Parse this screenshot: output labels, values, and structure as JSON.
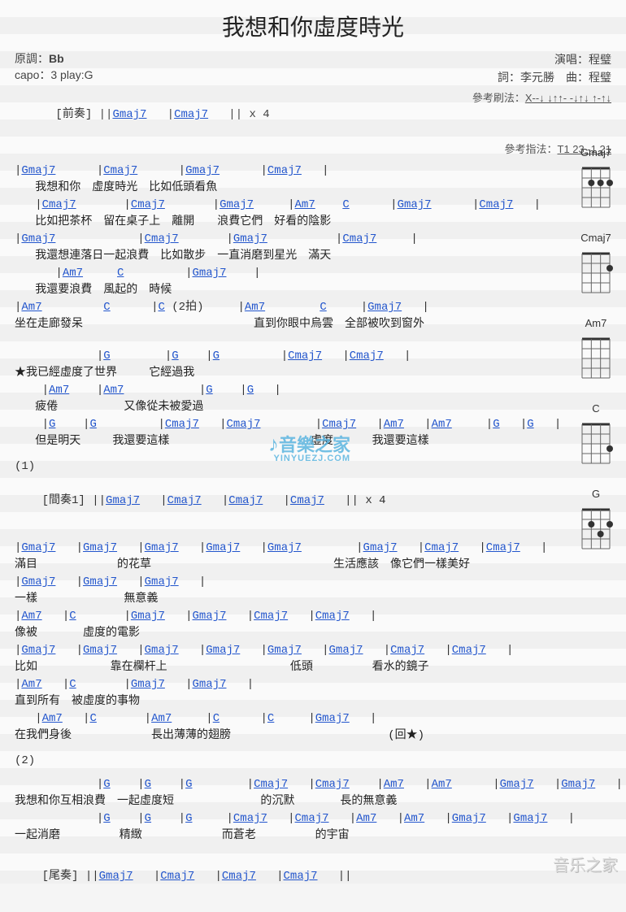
{
  "title": "我想和你虛度時光",
  "meta": {
    "key_label": "原調：",
    "key": "Bb",
    "capo": "capo：3 play:G",
    "singer_label": "演唱：",
    "singer": "程璧",
    "lyricist_label": "詞：",
    "lyricist": "李元勝",
    "composer_label": "曲：",
    "composer": "程璧"
  },
  "ref": {
    "strum_label": "參考刷法：",
    "strum": "X--↓ ↓↑↑- -↓↑↓ ↑-↑↓",
    "finger_label": "參考指法：",
    "finger": "T1 23 -1 21"
  },
  "intro": {
    "label": "[前奏]",
    "text": " ||Gmaj7   |Cmaj7   || x 4"
  },
  "verse1": [
    {
      "chords": "|Gmaj7      |Cmaj7      |Gmaj7      |Cmaj7   |",
      "lyrics": "   我想和你　虛度時光　比如低頭看魚"
    },
    {
      "chords": "   |Cmaj7       |Cmaj7       |Gmaj7     |Am7    C      |Gmaj7      |Cmaj7   |",
      "lyrics": "   比如把茶杯　留在桌子上　離開　　浪費它們　好看的陰影"
    },
    {
      "chords": "|Gmaj7            |Cmaj7       |Gmaj7          |Cmaj7     |",
      "lyrics": "   我還想連落日一起浪費　比如散步　一直消磨到星光　滿天"
    },
    {
      "chords": "      |Am7     C         |Gmaj7    |",
      "lyrics": "   我還要浪費　風起的　時候"
    },
    {
      "chords": "|Am7         C      |C (2拍)     |Am7        C     |Gmaj7   |",
      "lyrics": "坐在走廊發呆                         直到你眼中烏雲　全部被吹到窗外"
    }
  ],
  "chorus": [
    {
      "chords": "            |G        |G    |G         |Cmaj7   |Cmaj7   |",
      "lyrics": "★我已經虛度了世界　   它經過我"
    },
    {
      "chords": "    |Am7    |Am7           |G    |G   |",
      "lyrics": "   疲倦　        又像從未被愛過"
    },
    {
      "chords": "    |G    |G         |Cmaj7   |Cmaj7        |Cmaj7   |Am7   |Am7     |G   |G   |",
      "lyrics": "   但是明天　   我還要這樣　                   虛度　    我還要這樣"
    }
  ],
  "section1_label": "(1)",
  "interlude": {
    "label": "[間奏1]",
    "text": " ||Gmaj7   |Cmaj7   |Cmaj7   |Cmaj7   || x 4"
  },
  "verse2": [
    {
      "chords": "|Gmaj7   |Gmaj7   |Gmaj7   |Gmaj7   |Gmaj7        |Gmaj7   |Cmaj7   |Cmaj7   |",
      "lyrics": "滿目　          的花草　                         生活應該　像它們一樣美好"
    },
    {
      "chords": "|Gmaj7   |Gmaj7   |Gmaj7   |",
      "lyrics": "一樣　           無意義"
    },
    {
      "chords": "|Am7   |C       |Gmaj7   |Gmaj7   |Cmaj7   |Cmaj7   |",
      "lyrics": "像被　     虛度的電影"
    },
    {
      "chords": "|Gmaj7   |Gmaj7   |Gmaj7   |Gmaj7   |Gmaj7   |Gmaj7   |Cmaj7   |Cmaj7   |",
      "lyrics": "比如　         靠在欄杆上                  低頭　       看水的鏡子"
    },
    {
      "chords": "|Am7   |C       |Gmaj7   |Gmaj7   |",
      "lyrics": "直到所有　被虛度的事物"
    },
    {
      "chords": "   |Am7   |C       |Am7     |C      |C     |Gmaj7   |",
      "lyrics": "在我們身後　          長出薄薄的翅膀                       (回★)"
    }
  ],
  "section2_label": "(2)",
  "verse3": [
    {
      "chords": "            |G    |G    |G        |Cmaj7   |Cmaj7    |Am7   |Am7      |Gmaj7   |Gmaj7   |",
      "lyrics": "我想和你互相浪費　一起虛度短　           的沉默　     長的無意義"
    },
    {
      "chords": "            |G    |G    |G     |Cmaj7   |Cmaj7   |Am7   |Am7   |Gmaj7   |Gmaj7   |",
      "lyrics": "一起消磨　       精緻　          而蒼老　       的宇宙"
    }
  ],
  "outro": {
    "label": "[尾奏]",
    "text": " ||Gmaj7   |Cmaj7   |Cmaj7   |Cmaj7   ||"
  },
  "diagrams": [
    {
      "name": "Gmaj7",
      "frets": [
        0,
        2,
        2,
        2
      ]
    },
    {
      "name": "Cmaj7",
      "frets": [
        0,
        0,
        0,
        2
      ]
    },
    {
      "name": "Am7",
      "frets": [
        0,
        0,
        0,
        0
      ]
    },
    {
      "name": "C",
      "frets": [
        0,
        0,
        0,
        3
      ]
    },
    {
      "name": "G",
      "frets": [
        0,
        2,
        3,
        2
      ]
    }
  ],
  "watermark1": "音樂之家",
  "watermark1_sub": "YINYUEZJ.COM",
  "watermark2": "音乐之家"
}
